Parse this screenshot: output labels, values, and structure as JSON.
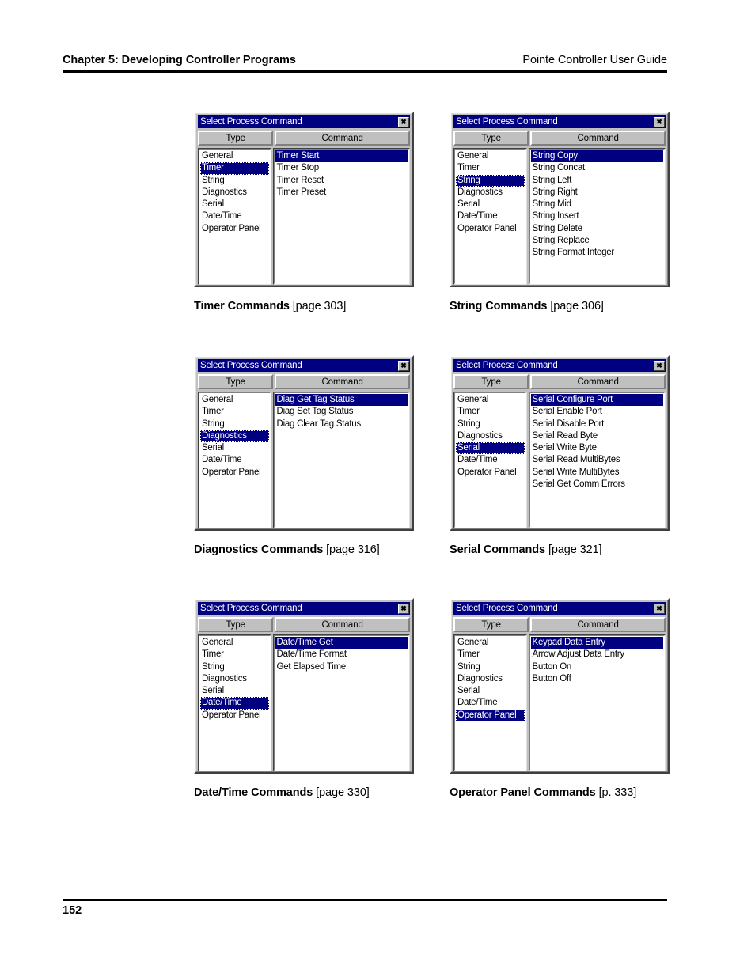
{
  "header": {
    "chapter": "Chapter 5: Developing Controller Programs",
    "guide": "Pointe Controller User Guide"
  },
  "footer": {
    "page_number": "152"
  },
  "colors": {
    "titlebar": "#000080",
    "selection": "#000080",
    "dialog_face": "#c0c0c0",
    "listbox": "#ffffff"
  },
  "dialog_common": {
    "title": "Select Process Command",
    "close_icon": "close-icon",
    "close_glyph": "✖",
    "type_header": "Type",
    "command_header": "Command",
    "types": [
      "General",
      "Timer",
      "String",
      "Diagnostics",
      "Serial",
      "Date/Time",
      "Operator Panel"
    ]
  },
  "figures": [
    {
      "id": "timer",
      "selected_type": "Timer",
      "selected_type_index": 1,
      "commands": [
        "Timer Start",
        "Timer Stop",
        "Timer Reset",
        "Timer Preset"
      ],
      "selected_command": "Timer Start",
      "selected_command_index": 0,
      "caption_title": "Timer Commands",
      "caption_page": "[page 303]"
    },
    {
      "id": "string",
      "selected_type": "String",
      "selected_type_index": 2,
      "commands": [
        "String Copy",
        "String Concat",
        "String Left",
        "String Right",
        "String Mid",
        "String Insert",
        "String Delete",
        "String Replace",
        "String Format Integer"
      ],
      "selected_command": "String Copy",
      "selected_command_index": 0,
      "caption_title": "String Commands",
      "caption_page": "[page 306]"
    },
    {
      "id": "diagnostics",
      "selected_type": "Diagnostics",
      "selected_type_index": 3,
      "commands": [
        "Diag Get Tag Status",
        "Diag Set Tag Status",
        "Diag Clear Tag Status"
      ],
      "selected_command": "Diag Get Tag Status",
      "selected_command_index": 0,
      "caption_title": "Diagnostics Commands",
      "caption_page": "[page 316]"
    },
    {
      "id": "serial",
      "selected_type": "Serial",
      "selected_type_index": 4,
      "commands": [
        "Serial Configure Port",
        "Serial Enable Port",
        "Serial Disable Port",
        "Serial Read Byte",
        "Serial Write Byte",
        "Serial Read MultiBytes",
        "Serial Write MultiBytes",
        "Serial Get Comm Errors"
      ],
      "selected_command": "Serial Configure Port",
      "selected_command_index": 0,
      "caption_title": "Serial Commands",
      "caption_page": "[page 321]"
    },
    {
      "id": "datetime",
      "selected_type": "Date/Time",
      "selected_type_index": 5,
      "commands": [
        "Date/Time Get",
        "Date/Time Format",
        "Get Elapsed Time"
      ],
      "selected_command": "Date/Time Get",
      "selected_command_index": 0,
      "caption_title": "Date/Time Commands",
      "caption_page": "[page 330]"
    },
    {
      "id": "operator-panel",
      "selected_type": "Operator Panel",
      "selected_type_index": 6,
      "commands": [
        "Keypad Data Entry",
        "Arrow Adjust Data Entry",
        "Button On",
        "Button Off"
      ],
      "selected_command": "Keypad Data Entry",
      "selected_command_index": 0,
      "caption_title": "Operator Panel Commands",
      "caption_page": "[p. 333]"
    }
  ]
}
